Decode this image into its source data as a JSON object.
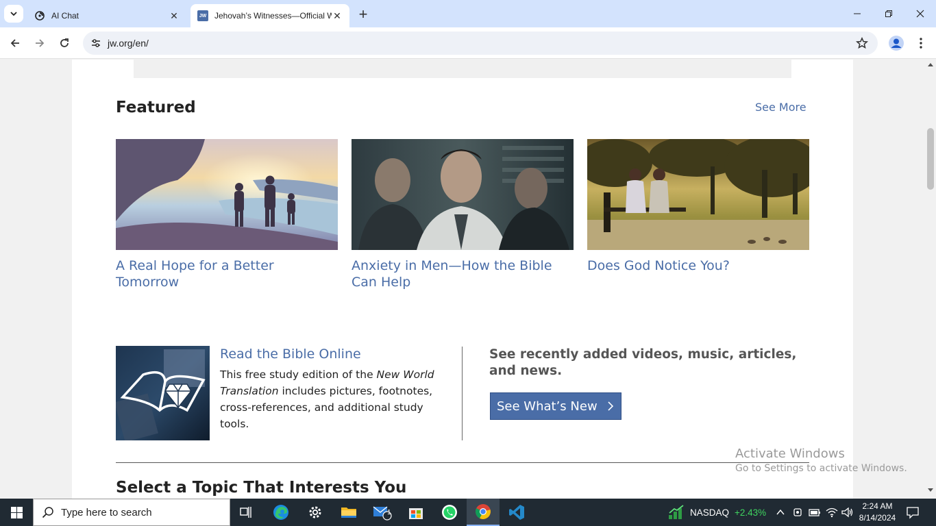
{
  "browser": {
    "tabs": [
      {
        "title": "AI Chat",
        "active": false
      },
      {
        "title": "Jehovah’s Witnesses—Official Website",
        "active": true,
        "favicon_text": "JW"
      }
    ],
    "url": "jw.org/en/"
  },
  "page": {
    "featured": {
      "title": "Featured",
      "see_more": "See More",
      "cards": [
        {
          "caption": "A Real Hope for a Better Tomorrow"
        },
        {
          "caption": "Anxiety in Men—How the Bible Can Help"
        },
        {
          "caption": "Does God Notice You?"
        }
      ]
    },
    "bible": {
      "heading": "Read the Bible Online",
      "desc_before": "This free study edition of the ",
      "desc_em": "New World Translation",
      "desc_after": " includes pictures, footnotes, cross-references, and additional study tools."
    },
    "news": {
      "text": "See recently added videos, music, articles, and news.",
      "button": "See What’s New"
    },
    "topics_title": "Select a Topic That Interests You"
  },
  "watermark": {
    "line1": "Activate Windows",
    "line2": "Go to Settings to activate Windows."
  },
  "taskbar": {
    "search_placeholder": "Type here to search",
    "mail_badge": "1",
    "ticker": {
      "name": "NASDAQ",
      "change": "+2.43%"
    },
    "time": "2:24 AM",
    "date": "8/14/2024"
  },
  "colors": {
    "link": "#4a6da7",
    "tabstrip": "#d3e3fd",
    "taskbar": "#202a33",
    "ticker_up": "#3fd45f"
  }
}
